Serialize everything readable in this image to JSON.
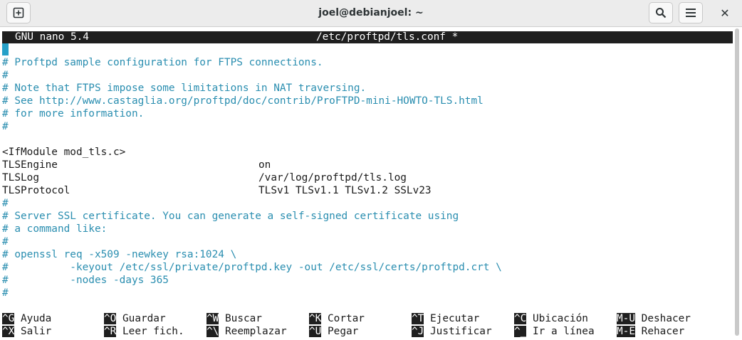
{
  "window": {
    "title": "joel@debianjoel: ~"
  },
  "nano": {
    "version": "GNU nano 5.4",
    "filename": "/etc/proftpd/tls.conf *",
    "lines": [
      {
        "type": "cursor",
        "text": "#"
      },
      {
        "type": "comment",
        "text": "# Proftpd sample configuration for FTPS connections."
      },
      {
        "type": "comment",
        "text": "#"
      },
      {
        "type": "comment",
        "text": "# Note that FTPS impose some limitations in NAT traversing."
      },
      {
        "type": "comment",
        "text": "# See http://www.castaglia.org/proftpd/doc/contrib/ProFTPD-mini-HOWTO-TLS.html"
      },
      {
        "type": "comment",
        "text": "# for more information."
      },
      {
        "type": "comment",
        "text": "#"
      },
      {
        "type": "blank",
        "text": ""
      },
      {
        "type": "text",
        "text": "<IfModule mod_tls.c>"
      },
      {
        "type": "kv",
        "key": "TLSEngine",
        "value": "on"
      },
      {
        "type": "kv",
        "key": "TLSLog",
        "value": "/var/log/proftpd/tls.log"
      },
      {
        "type": "kv",
        "key": "TLSProtocol",
        "value": "TLSv1 TLSv1.1 TLSv1.2 SSLv23"
      },
      {
        "type": "comment",
        "text": "#"
      },
      {
        "type": "comment",
        "text": "# Server SSL certificate. You can generate a self-signed certificate using"
      },
      {
        "type": "comment",
        "text": "# a command like:"
      },
      {
        "type": "comment",
        "text": "#"
      },
      {
        "type": "comment",
        "text": "# openssl req -x509 -newkey rsa:1024 \\"
      },
      {
        "type": "comment",
        "text": "#          -keyout /etc/ssl/private/proftpd.key -out /etc/ssl/certs/proftpd.crt \\"
      },
      {
        "type": "comment",
        "text": "#          -nodes -days 365"
      },
      {
        "type": "comment",
        "text": "#"
      }
    ],
    "shortcuts_row1": [
      {
        "key": "^G",
        "label": "Ayuda"
      },
      {
        "key": "^O",
        "label": "Guardar"
      },
      {
        "key": "^W",
        "label": "Buscar"
      },
      {
        "key": "^K",
        "label": "Cortar"
      },
      {
        "key": "^T",
        "label": "Ejecutar"
      },
      {
        "key": "^C",
        "label": "Ubicación"
      },
      {
        "key": "M-U",
        "label": "Deshacer"
      }
    ],
    "shortcuts_row2": [
      {
        "key": "^X",
        "label": "Salir"
      },
      {
        "key": "^R",
        "label": "Leer fich."
      },
      {
        "key": "^\\",
        "label": "Reemplazar"
      },
      {
        "key": "^U",
        "label": "Pegar"
      },
      {
        "key": "^J",
        "label": "Justificar"
      },
      {
        "key": "^_",
        "label": "Ir a línea"
      },
      {
        "key": "M-E",
        "label": "Rehacer"
      }
    ]
  }
}
